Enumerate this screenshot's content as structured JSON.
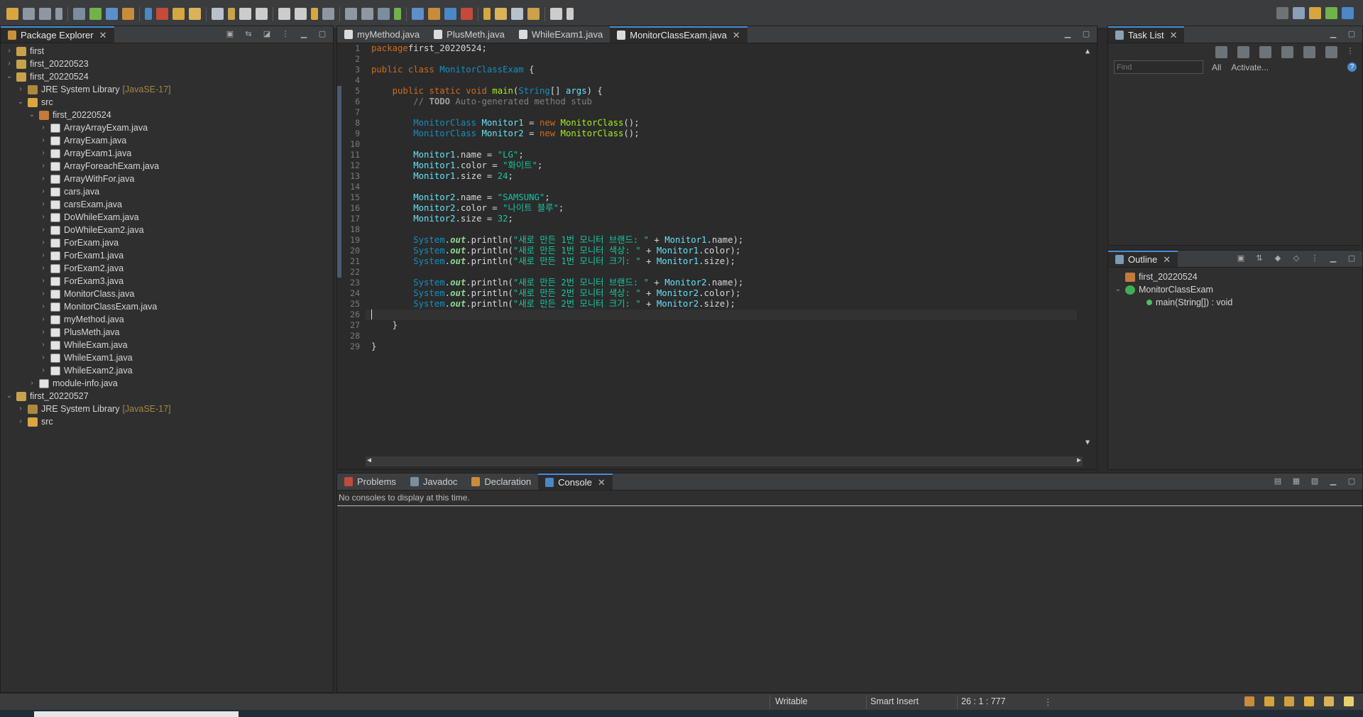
{
  "toolbar": {
    "icons": [
      "new-icon",
      "save-icon",
      "save-all-icon",
      "print-icon",
      "debug-icon",
      "run-icon",
      "external-tools-icon",
      "open-type-icon",
      "search-icon",
      "back-icon",
      "forward-icon",
      "perspective-icon"
    ]
  },
  "package_explorer": {
    "title": "Package Explorer",
    "items": [
      {
        "label": "first",
        "depth": 0,
        "twisty": "›",
        "icon": "proj"
      },
      {
        "label": "first_20220523",
        "depth": 0,
        "twisty": "›",
        "icon": "proj"
      },
      {
        "label": "first_20220524",
        "depth": 0,
        "twisty": "⌄",
        "icon": "proj"
      },
      {
        "label": "JRE System Library",
        "extra": "[JavaSE-17]",
        "depth": 1,
        "twisty": "›",
        "icon": "lib"
      },
      {
        "label": "src",
        "depth": 1,
        "twisty": "⌄",
        "icon": "folder"
      },
      {
        "label": "first_20220524",
        "depth": 2,
        "twisty": "⌄",
        "icon": "pkg"
      },
      {
        "label": "ArrayArrayExam.java",
        "depth": 3,
        "twisty": "›",
        "icon": "java"
      },
      {
        "label": "ArrayExam.java",
        "depth": 3,
        "twisty": "›",
        "icon": "java"
      },
      {
        "label": "ArrayExam1.java",
        "depth": 3,
        "twisty": "›",
        "icon": "java"
      },
      {
        "label": "ArrayForeachExam.java",
        "depth": 3,
        "twisty": "›",
        "icon": "java"
      },
      {
        "label": "ArrayWithFor.java",
        "depth": 3,
        "twisty": "›",
        "icon": "java"
      },
      {
        "label": "cars.java",
        "depth": 3,
        "twisty": "›",
        "icon": "java"
      },
      {
        "label": "carsExam.java",
        "depth": 3,
        "twisty": "›",
        "icon": "java"
      },
      {
        "label": "DoWhileExam.java",
        "depth": 3,
        "twisty": "›",
        "icon": "java"
      },
      {
        "label": "DoWhileExam2.java",
        "depth": 3,
        "twisty": "›",
        "icon": "java"
      },
      {
        "label": "ForExam.java",
        "depth": 3,
        "twisty": "›",
        "icon": "java"
      },
      {
        "label": "ForExam1.java",
        "depth": 3,
        "twisty": "›",
        "icon": "java"
      },
      {
        "label": "ForExam2.java",
        "depth": 3,
        "twisty": "›",
        "icon": "java"
      },
      {
        "label": "ForExam3.java",
        "depth": 3,
        "twisty": "›",
        "icon": "java"
      },
      {
        "label": "MonitorClass.java",
        "depth": 3,
        "twisty": "›",
        "icon": "java"
      },
      {
        "label": "MonitorClassExam.java",
        "depth": 3,
        "twisty": "›",
        "icon": "java"
      },
      {
        "label": "myMethod.java",
        "depth": 3,
        "twisty": "›",
        "icon": "java"
      },
      {
        "label": "PlusMeth.java",
        "depth": 3,
        "twisty": "›",
        "icon": "java"
      },
      {
        "label": "WhileExam.java",
        "depth": 3,
        "twisty": "›",
        "icon": "java"
      },
      {
        "label": "WhileExam1.java",
        "depth": 3,
        "twisty": "›",
        "icon": "java"
      },
      {
        "label": "WhileExam2.java",
        "depth": 3,
        "twisty": "›",
        "icon": "java"
      },
      {
        "label": "module-info.java",
        "depth": 2,
        "twisty": "›",
        "icon": "java"
      },
      {
        "label": "first_20220527",
        "depth": 0,
        "twisty": "⌄",
        "icon": "proj"
      },
      {
        "label": "JRE System Library",
        "extra": "[JavaSE-17]",
        "depth": 1,
        "twisty": "›",
        "icon": "lib"
      },
      {
        "label": "src",
        "depth": 1,
        "twisty": "›",
        "icon": "folder"
      }
    ]
  },
  "editor": {
    "tabs": [
      {
        "label": "myMethod.java",
        "active": false
      },
      {
        "label": "PlusMeth.java",
        "active": false
      },
      {
        "label": "WhileExam1.java",
        "active": false
      },
      {
        "label": "MonitorClassExam.java",
        "active": true
      }
    ],
    "current_line": 26,
    "lines": [
      [
        [
          "kw",
          "package"
        ],
        [
          "",
          "first_20220524;"
        ]
      ],
      [],
      [
        [
          "kw",
          "public class"
        ],
        [
          "ty",
          " MonitorClassExam"
        ],
        [
          "",
          " {"
        ]
      ],
      [],
      [
        [
          "",
          "    "
        ],
        [
          "kw",
          "public static void"
        ],
        [
          "mth",
          " main"
        ],
        [
          "",
          "("
        ],
        [
          "ty",
          "String"
        ],
        [
          "",
          "[] "
        ],
        [
          "fld",
          "args"
        ],
        [
          "",
          ") {"
        ]
      ],
      [
        [
          "cmt",
          "        // "
        ],
        [
          "todo",
          "TODO"
        ],
        [
          "cmt",
          " Auto-generated method stub"
        ]
      ],
      [],
      [
        [
          "ty",
          "        MonitorClass"
        ],
        [
          "fld",
          " Monitor1"
        ],
        [
          "",
          " = "
        ],
        [
          "kw",
          "new"
        ],
        [
          "mth",
          " MonitorClass"
        ],
        [
          "",
          "();"
        ]
      ],
      [
        [
          "ty",
          "        MonitorClass"
        ],
        [
          "fld",
          " Monitor2"
        ],
        [
          "",
          " = "
        ],
        [
          "kw",
          "new"
        ],
        [
          "mth",
          " MonitorClass"
        ],
        [
          "",
          "();"
        ]
      ],
      [],
      [
        [
          "fld",
          "        Monitor1"
        ],
        [
          "",
          ".name = "
        ],
        [
          "str",
          "\"LG\""
        ],
        [
          "",
          ";"
        ]
      ],
      [
        [
          "fld",
          "        Monitor1"
        ],
        [
          "",
          ".color = "
        ],
        [
          "str",
          "\"화이트\""
        ],
        [
          "",
          ";"
        ]
      ],
      [
        [
          "fld",
          "        Monitor1"
        ],
        [
          "",
          ".size = "
        ],
        [
          "str",
          "24"
        ],
        [
          "",
          ";"
        ]
      ],
      [],
      [
        [
          "fld",
          "        Monitor2"
        ],
        [
          "",
          ".name = "
        ],
        [
          "str",
          "\"SAMSUNG\""
        ],
        [
          "",
          ";"
        ]
      ],
      [
        [
          "fld",
          "        Monitor2"
        ],
        [
          "",
          ".color = "
        ],
        [
          "str",
          "\"나이트 블루\""
        ],
        [
          "",
          ";"
        ]
      ],
      [
        [
          "fld",
          "        Monitor2"
        ],
        [
          "",
          ".size = "
        ],
        [
          "str",
          "32"
        ],
        [
          "",
          ";"
        ]
      ],
      [],
      [
        [
          "ty",
          "        System"
        ],
        [
          "",
          "."
        ],
        [
          "stf",
          "out"
        ],
        [
          "",
          ".println("
        ],
        [
          "str",
          "\"새로 만든 1번 모니터 브랜드: \""
        ],
        [
          "",
          " + "
        ],
        [
          "fld",
          "Monitor1"
        ],
        [
          "",
          ".name);"
        ]
      ],
      [
        [
          "ty",
          "        System"
        ],
        [
          "",
          "."
        ],
        [
          "stf",
          "out"
        ],
        [
          "",
          ".println("
        ],
        [
          "str",
          "\"새로 만든 1번 모니터 색상: \""
        ],
        [
          "",
          " + "
        ],
        [
          "fld",
          "Monitor1"
        ],
        [
          "",
          ".color);"
        ]
      ],
      [
        [
          "ty",
          "        System"
        ],
        [
          "",
          "."
        ],
        [
          "stf",
          "out"
        ],
        [
          "",
          ".println("
        ],
        [
          "str",
          "\"새로 만든 1번 모니터 크기: \""
        ],
        [
          "",
          " + "
        ],
        [
          "fld",
          "Monitor1"
        ],
        [
          "",
          ".size);"
        ]
      ],
      [],
      [
        [
          "ty",
          "        System"
        ],
        [
          "",
          "."
        ],
        [
          "stf",
          "out"
        ],
        [
          "",
          ".println("
        ],
        [
          "str",
          "\"새로 만든 2번 모니터 브랜드: \""
        ],
        [
          "",
          " + "
        ],
        [
          "fld",
          "Monitor2"
        ],
        [
          "",
          ".name);"
        ]
      ],
      [
        [
          "ty",
          "        System"
        ],
        [
          "",
          "."
        ],
        [
          "stf",
          "out"
        ],
        [
          "",
          ".println("
        ],
        [
          "str",
          "\"새로 만든 2번 모니터 색상: \""
        ],
        [
          "",
          " + "
        ],
        [
          "fld",
          "Monitor2"
        ],
        [
          "",
          ".color);"
        ]
      ],
      [
        [
          "ty",
          "        System"
        ],
        [
          "",
          "."
        ],
        [
          "stf",
          "out"
        ],
        [
          "",
          ".println("
        ],
        [
          "str",
          "\"새로 만든 2번 모니터 크기: \""
        ],
        [
          "",
          " + "
        ],
        [
          "fld",
          "Monitor2"
        ],
        [
          "",
          ".size);"
        ]
      ],
      [],
      [
        [
          "",
          "    }"
        ]
      ],
      [],
      [
        [
          "",
          "}"
        ]
      ]
    ]
  },
  "task_list": {
    "title": "Task List",
    "find_placeholder": "Find",
    "all": "All",
    "activate": "Activate..."
  },
  "outline": {
    "title": "Outline",
    "items": [
      {
        "label": "first_20220524",
        "depth": 0,
        "icon": "pkg"
      },
      {
        "label": "MonitorClassExam",
        "depth": 0,
        "icon": "class",
        "twisty": "⌄"
      },
      {
        "label": "main(String[]) : void",
        "depth": 1,
        "icon": "method"
      }
    ]
  },
  "bottom": {
    "tabs": [
      {
        "label": "Problems",
        "active": false
      },
      {
        "label": "Javadoc",
        "active": false
      },
      {
        "label": "Declaration",
        "active": false
      },
      {
        "label": "Console",
        "active": true
      }
    ],
    "console_message": "No consoles to display at this time."
  },
  "status": {
    "writable": "Writable",
    "insert_mode": "Smart Insert",
    "position": "26 : 1 : 777"
  }
}
